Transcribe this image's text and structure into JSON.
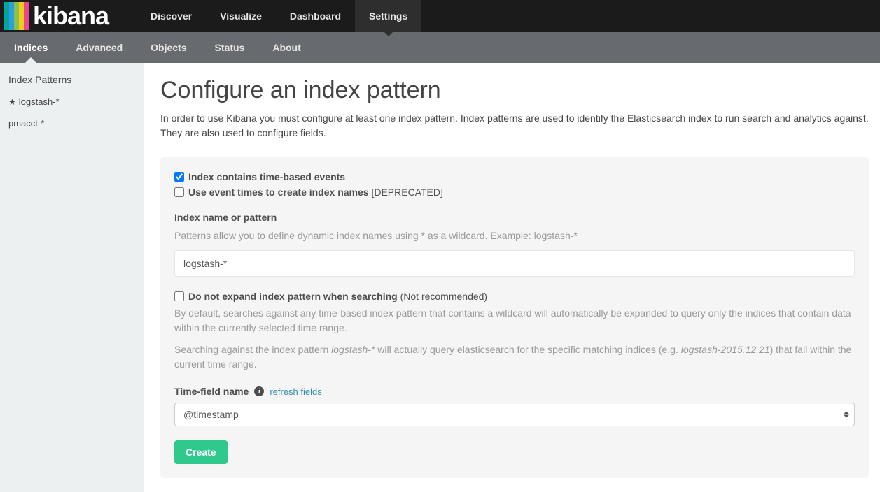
{
  "logo": {
    "text": "kibana"
  },
  "topnav": {
    "items": [
      {
        "label": "Discover",
        "active": false
      },
      {
        "label": "Visualize",
        "active": false
      },
      {
        "label": "Dashboard",
        "active": false
      },
      {
        "label": "Settings",
        "active": true
      }
    ]
  },
  "subnav": {
    "items": [
      {
        "label": "Indices",
        "active": true
      },
      {
        "label": "Advanced",
        "active": false
      },
      {
        "label": "Objects",
        "active": false
      },
      {
        "label": "Status",
        "active": false
      },
      {
        "label": "About",
        "active": false
      }
    ]
  },
  "sidebar": {
    "header": "Index Patterns",
    "items": [
      {
        "label": "logstash-*",
        "starred": true
      },
      {
        "label": "pmacct-*",
        "starred": false
      }
    ]
  },
  "page": {
    "title": "Configure an index pattern",
    "description": "In order to use Kibana you must configure at least one index pattern. Index patterns are used to identify the Elasticsearch index to run search and analytics against. They are also used to configure fields."
  },
  "form": {
    "time_based": {
      "label": "Index contains time-based events",
      "checked": true
    },
    "event_times": {
      "label": "Use event times to create index names",
      "deprecated": "[DEPRECATED]",
      "checked": false
    },
    "index_name": {
      "label": "Index name or pattern",
      "help": "Patterns allow you to define dynamic index names using * as a wildcard. Example: logstash-*",
      "value": "logstash-*"
    },
    "no_expand": {
      "label": "Do not expand index pattern when searching",
      "not_recommended": "(Not recommended)",
      "checked": false,
      "help1": "By default, searches against any time-based index pattern that contains a wildcard will automatically be expanded to query only the indices that contain data within the currently selected time range.",
      "help2_a": "Searching against the index pattern ",
      "help2_em1": "logstash-*",
      "help2_b": " will actually query elasticsearch for the specific matching indices (e.g. ",
      "help2_em2": "logstash-2015.12.21",
      "help2_c": ") that fall within the current time range."
    },
    "time_field": {
      "label": "Time-field name",
      "refresh": "refresh fields",
      "value": "@timestamp"
    },
    "create_label": "Create"
  }
}
